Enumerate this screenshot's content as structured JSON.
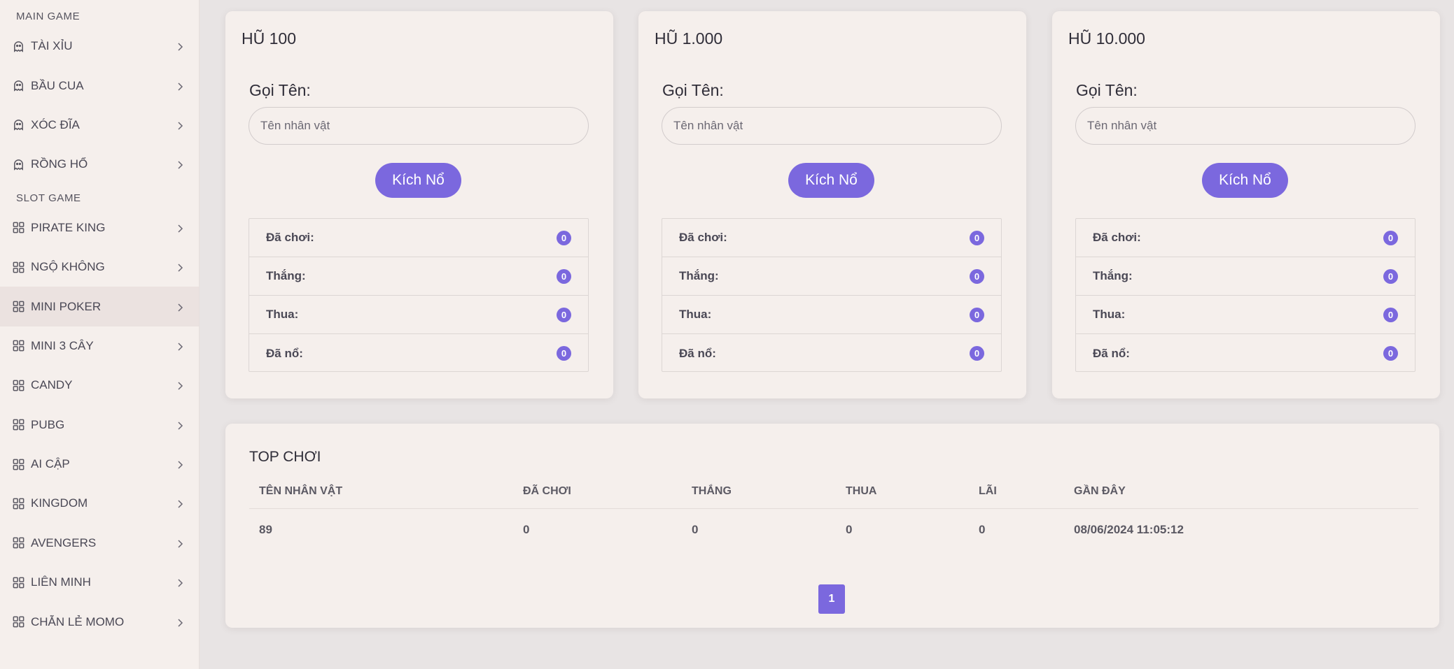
{
  "sidebar": {
    "main_label": "MAIN GAME",
    "slot_label": "SLOT GAME",
    "main_items": [
      {
        "label": "TÀI XỈU",
        "icon": "ghost-icon"
      },
      {
        "label": "BẦU CUA",
        "icon": "ghost-icon"
      },
      {
        "label": "XÓC ĐĨA",
        "icon": "ghost-icon"
      },
      {
        "label": "RỒNG HỔ",
        "icon": "ghost-icon"
      }
    ],
    "slot_items": [
      {
        "label": "PIRATE KING",
        "icon": "grid-icon"
      },
      {
        "label": "NGỘ KHÔNG",
        "icon": "grid-icon"
      },
      {
        "label": "MINI POKER",
        "icon": "grid-icon",
        "active": true
      },
      {
        "label": "MINI 3 CÂY",
        "icon": "grid-icon"
      },
      {
        "label": "CANDY",
        "icon": "grid-icon"
      },
      {
        "label": "PUBG",
        "icon": "grid-icon"
      },
      {
        "label": "AI CẬP",
        "icon": "grid-icon"
      },
      {
        "label": "KINGDOM",
        "icon": "grid-icon"
      },
      {
        "label": "AVENGERS",
        "icon": "grid-icon"
      },
      {
        "label": "LIÊN MINH",
        "icon": "grid-icon"
      },
      {
        "label": "CHẴN LẺ MOMO",
        "icon": "grid-icon"
      }
    ]
  },
  "jars": [
    {
      "title": "HŨ 100",
      "name_label": "Gọi Tên:",
      "name_placeholder": "Tên nhân vật",
      "button_label": "Kích Nổ",
      "stats": [
        {
          "label": "Đã chơi:",
          "value": "0"
        },
        {
          "label": "Thắng:",
          "value": "0"
        },
        {
          "label": "Thua:",
          "value": "0"
        },
        {
          "label": "Đã nổ:",
          "value": "0"
        }
      ]
    },
    {
      "title": "HŨ 1.000",
      "name_label": "Gọi Tên:",
      "name_placeholder": "Tên nhân vật",
      "button_label": "Kích Nổ",
      "stats": [
        {
          "label": "Đã chơi:",
          "value": "0"
        },
        {
          "label": "Thắng:",
          "value": "0"
        },
        {
          "label": "Thua:",
          "value": "0"
        },
        {
          "label": "Đã nổ:",
          "value": "0"
        }
      ]
    },
    {
      "title": "HŨ 10.000",
      "name_label": "Gọi Tên:",
      "name_placeholder": "Tên nhân vật",
      "button_label": "Kích Nổ",
      "stats": [
        {
          "label": "Đã chơi:",
          "value": "0"
        },
        {
          "label": "Thắng:",
          "value": "0"
        },
        {
          "label": "Thua:",
          "value": "0"
        },
        {
          "label": "Đã nổ:",
          "value": "0"
        }
      ]
    }
  ],
  "top_players": {
    "title": "TOP CHƠI",
    "columns": [
      "TÊN NHÂN VẬT",
      "ĐÃ CHƠI",
      "THẮNG",
      "THUA",
      "LÃI",
      "GẦN ĐÂY"
    ],
    "rows": [
      [
        "89",
        "0",
        "0",
        "0",
        "0",
        "08/06/2024 11:05:12"
      ]
    ],
    "pagination": {
      "current": "1"
    }
  },
  "colors": {
    "accent": "#7b68de",
    "background": "#e8e4e4",
    "card": "#f5efec"
  }
}
